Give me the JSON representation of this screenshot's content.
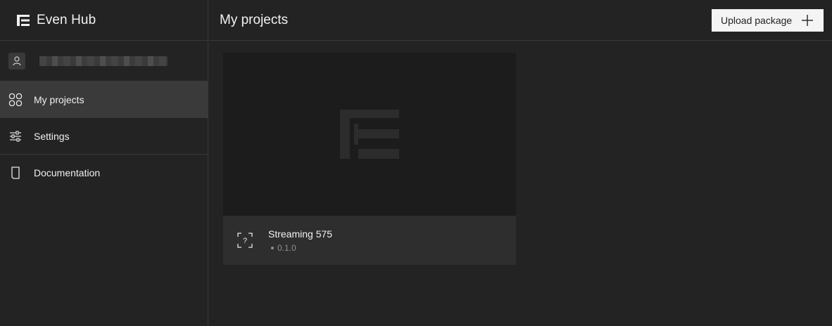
{
  "app": {
    "brand_name": "Even Hub"
  },
  "sidebar": {
    "items": [
      {
        "label": "My projects",
        "icon": "grid-icon",
        "active": true
      },
      {
        "label": "Settings",
        "icon": "sliders-icon",
        "active": false
      },
      {
        "label": "Documentation",
        "icon": "document-icon",
        "active": false
      }
    ]
  },
  "header": {
    "title": "My projects",
    "upload_label": "Upload package"
  },
  "projects": [
    {
      "name": "Streaming 575",
      "version": "0.1.0",
      "status_icon": "unknown-status-icon"
    }
  ],
  "colors": {
    "background": "#232323",
    "active_nav": "#3a3a3a",
    "card_footer": "#2e2e2e",
    "button": "#f4f4f4"
  }
}
